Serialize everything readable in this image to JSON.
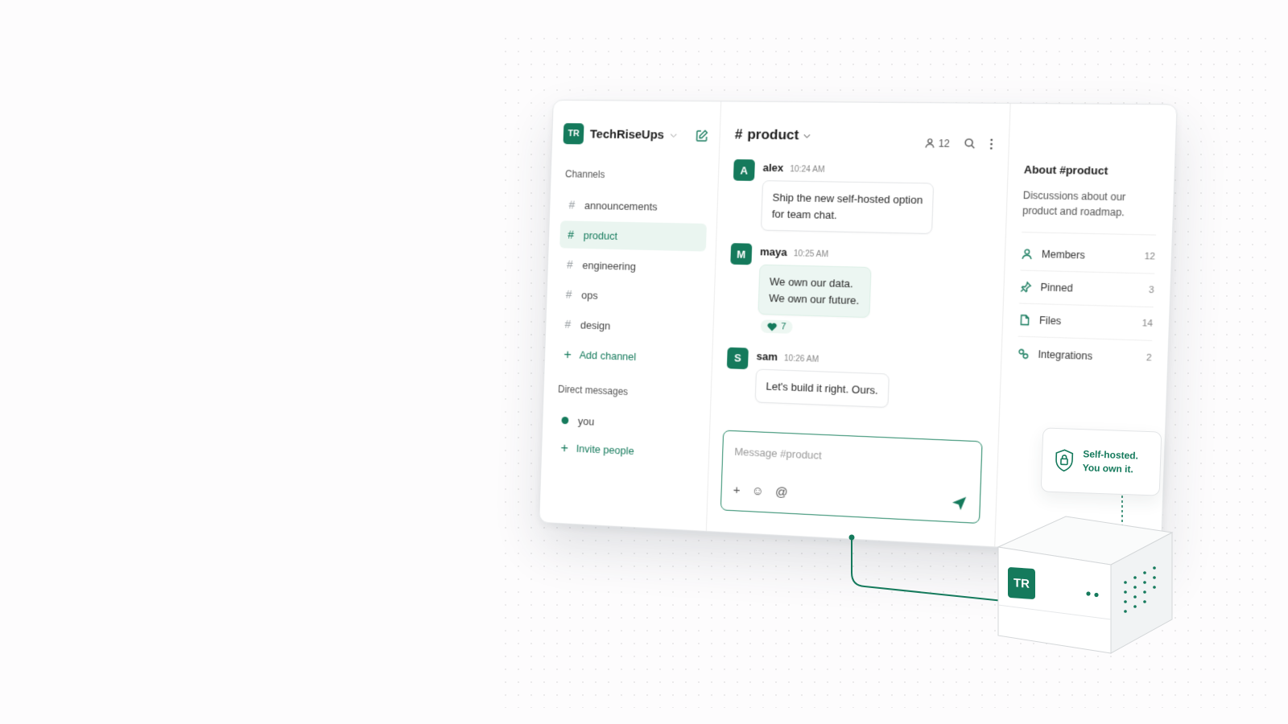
{
  "workspace": {
    "initials": "TR",
    "name": "TechRiseUps"
  },
  "sidebar": {
    "channels_label": "Channels",
    "channels": [
      {
        "name": "announcements",
        "active": false
      },
      {
        "name": "product",
        "active": true
      },
      {
        "name": "engineering",
        "active": false
      },
      {
        "name": "ops",
        "active": false
      },
      {
        "name": "design",
        "active": false
      }
    ],
    "add_channel": "Add channel",
    "dm_label": "Direct messages",
    "dms": [
      {
        "name": "you"
      }
    ],
    "invite": "Invite people"
  },
  "channel": {
    "hash": "#",
    "name": "product",
    "member_count": "12"
  },
  "messages": [
    {
      "initial": "A",
      "author": "alex",
      "time": "10:24 AM",
      "text": "Ship the new self-hosted option\nfor team chat.",
      "tint": false
    },
    {
      "initial": "M",
      "author": "maya",
      "time": "10:25 AM",
      "text": "We own our data.\nWe own our future.",
      "tint": true,
      "reaction": {
        "icon": "heart-icon",
        "count": "7"
      }
    },
    {
      "initial": "S",
      "author": "sam",
      "time": "10:26 AM",
      "text": "Let's build it right. Ours.",
      "tint": false
    }
  ],
  "composer": {
    "placeholder": "Message #product"
  },
  "about": {
    "title": "About #product",
    "description": "Discussions about our product and roadmap.",
    "rows": [
      {
        "icon": "person-icon",
        "label": "Members",
        "count": "12"
      },
      {
        "icon": "pin-icon",
        "label": "Pinned",
        "count": "3"
      },
      {
        "icon": "file-icon",
        "label": "Files",
        "count": "14"
      },
      {
        "icon": "integrations-icon",
        "label": "Integrations",
        "count": "2"
      }
    ]
  },
  "server": {
    "initials": "TR",
    "badge_line1": "Self-hosted.",
    "badge_line2": "You own it."
  },
  "colors": {
    "accent": "#157a5c",
    "accent_light": "#eaf5f0"
  }
}
